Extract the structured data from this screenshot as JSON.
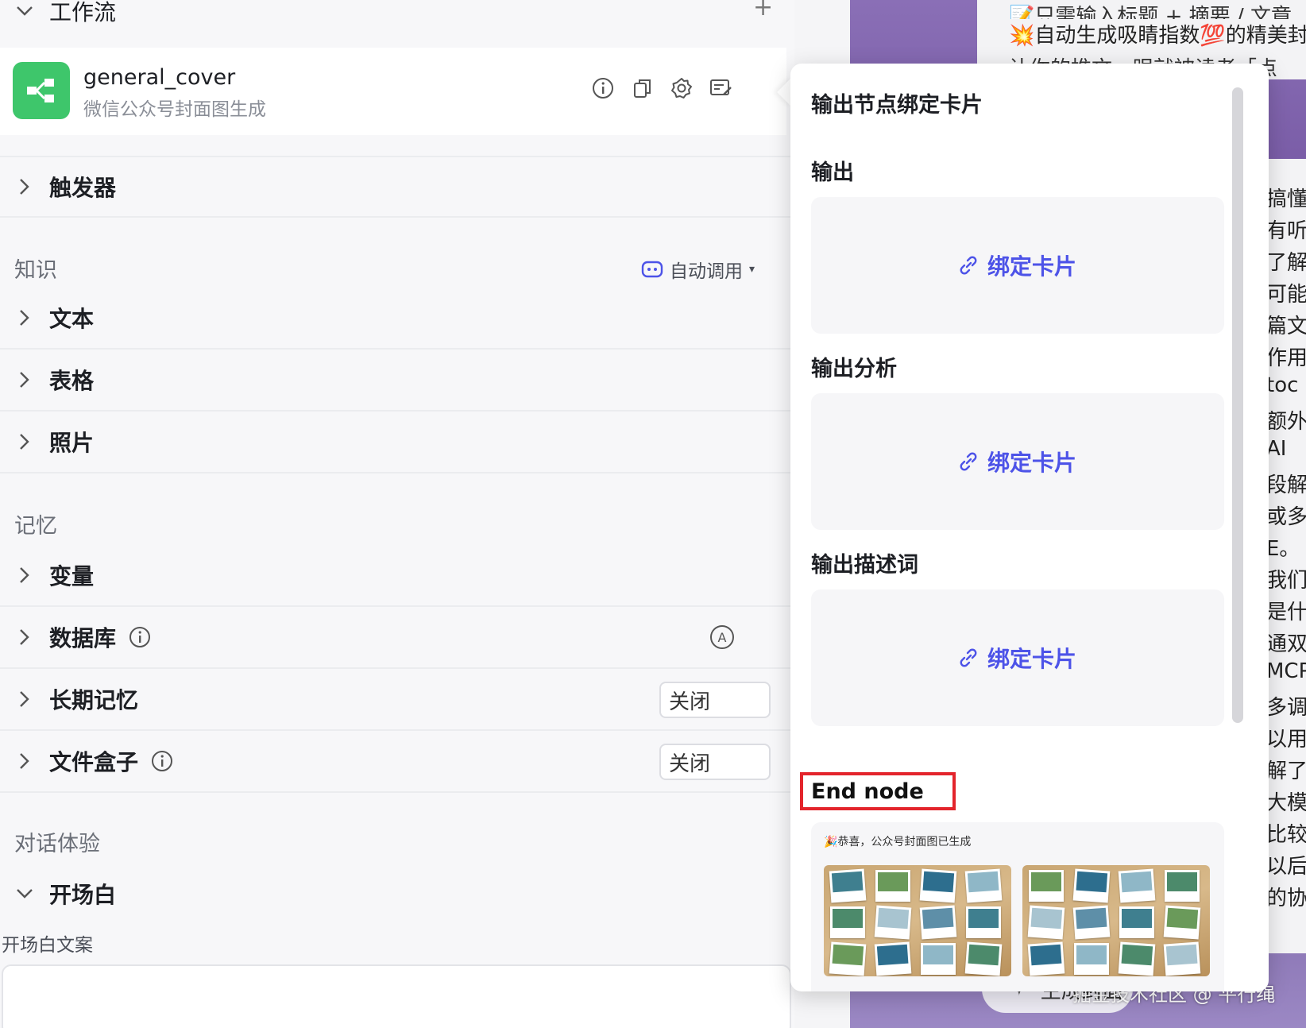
{
  "sections": {
    "workflow": "工作流",
    "knowledge": "知识",
    "memory": "记忆",
    "dialog": "对话体验"
  },
  "workflow": {
    "name": "general_cover",
    "description": "微信公众号封面图生成"
  },
  "knowledge": {
    "auto_call_label": "自动调用",
    "items": [
      "文本",
      "表格",
      "照片"
    ]
  },
  "trigger_label": "触发器",
  "memory": {
    "variables": "变量",
    "database": "数据库",
    "long_term": "长期记忆",
    "long_term_value": "关闭",
    "file_box": "文件盒子",
    "file_box_value": "关闭",
    "database_badge": "A"
  },
  "dialog": {
    "opening": "开场白",
    "opening_text_label": "开场白文案"
  },
  "popup": {
    "title": "输出节点绑定卡片",
    "outputs": [
      {
        "label": "输出",
        "bind": "绑定卡片"
      },
      {
        "label": "输出分析",
        "bind": "绑定卡片"
      },
      {
        "label": "输出描述词",
        "bind": "绑定卡片"
      }
    ],
    "end_node": "End node",
    "result_text": "🎉恭喜，公众号封面图已生成"
  },
  "background": {
    "top_line1": "📝只需输入标题 + 摘要 / 文章",
    "top_line2": "💥自动生成吸睛指数💯的精美封",
    "top_line3": "让你的推文一眼就被读者「点",
    "side_lines": [
      "搞懂了",
      "有听",
      "了解",
      "可能",
      "篇文章",
      "作用!",
      "toc",
      "额外部",
      "AI",
      "段解释",
      "或多",
      "E。",
      "我们都",
      "是什么",
      "通双方",
      "MCP",
      "多调用",
      "以用",
      "解了",
      "大模型",
      "比较多",
      "以后就",
      "的协"
    ],
    "pill_label": "生成封面",
    "watermark": "掘金技术社区 @ 平行绳"
  },
  "colors": {
    "accent": "#4d53e8",
    "workflow_icon": "#3ec66b",
    "highlight_border": "#e3242b"
  }
}
